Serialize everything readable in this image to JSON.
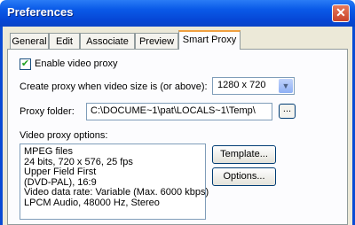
{
  "window": {
    "title": "Preferences",
    "close_glyph": "✕"
  },
  "tabs": [
    {
      "label": "General"
    },
    {
      "label": "Edit"
    },
    {
      "label": "Associate"
    },
    {
      "label": "Preview"
    },
    {
      "label": "Smart Proxy",
      "active": true
    }
  ],
  "smart_proxy": {
    "enable_label": "Enable video proxy",
    "enable_checked": true,
    "create_proxy_label": "Create proxy when video size is (or above):",
    "proxy_size_value": "1280 x 720",
    "proxy_folder_label": "Proxy folder:",
    "proxy_folder_value": "C:\\DOCUME~1\\pat\\LOCALS~1\\Temp\\",
    "browse_label": "...",
    "options_label": "Video proxy options:",
    "options_lines": [
      "MPEG files",
      "24 bits, 720 x 576, 25 fps",
      "Upper Field First",
      "(DVD-PAL), 16:9",
      "Video data rate: Variable (Max. 6000 kbps)",
      "LPCM Audio, 48000 Hz, Stereo"
    ],
    "template_button": "Template...",
    "options_button": "Options..."
  },
  "icons": {
    "checkbox_check": "check-icon",
    "dropdown_arrow": "chevron-down-icon",
    "close": "close-icon"
  },
  "colors": {
    "titlebar": "#0a5ae8",
    "client_bg": "#ece9d8",
    "tab_accent": "#f0a040",
    "close_button": "#d6573b"
  }
}
